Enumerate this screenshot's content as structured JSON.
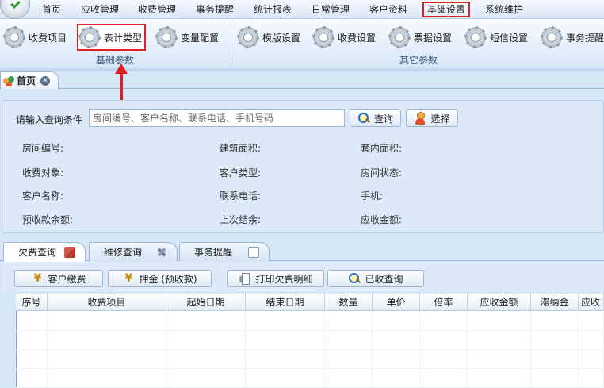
{
  "menu": {
    "items": [
      "首页",
      "应收管理",
      "收费管理",
      "事务提醒",
      "统计报表",
      "日常管理",
      "客户资料",
      "基础设置",
      "系统维护"
    ],
    "active_index": 7
  },
  "ribbon": {
    "groups": [
      {
        "label": "基础参数",
        "buttons": [
          "收费项目",
          "表计类型",
          "变量配置"
        ]
      },
      {
        "label": "其它参数",
        "buttons": [
          "模版设置",
          "收费设置",
          "票据设置",
          "短信设置",
          "事务提醒"
        ]
      }
    ],
    "highlighted_button": "表计类型"
  },
  "doc_tab": {
    "title": "首页"
  },
  "query": {
    "label": "请输入查询条件",
    "placeholder": "房间编号、客户名称、联系电话、手机号码",
    "search_button": "查询",
    "select_button": "选择"
  },
  "info_fields": [
    [
      "房间编号:",
      "建筑面积:",
      "套内面积:"
    ],
    [
      "收费对象:",
      "客户类型:",
      "房间状态:"
    ],
    [
      "客户名称:",
      "联系电话:",
      "手机:"
    ],
    [
      "预收款余额:",
      "上次结余:",
      "应收金额:"
    ]
  ],
  "content_tabs": [
    "欠费查询",
    "维修查询",
    "事务提醒"
  ],
  "active_content_tab": 0,
  "actions": [
    "客户缴费",
    "押金 (预收款)",
    "打印欠费明细",
    "已收查询"
  ],
  "table": {
    "columns": [
      "序号",
      "收费项目",
      "起始日期",
      "结束日期",
      "数量",
      "单价",
      "倍率",
      "应收金额",
      "滞纳金",
      "应收"
    ],
    "rows": []
  },
  "colors": {
    "highlight": "#e02020",
    "panel": "#dce9f8",
    "accent": "#3a5b82"
  }
}
